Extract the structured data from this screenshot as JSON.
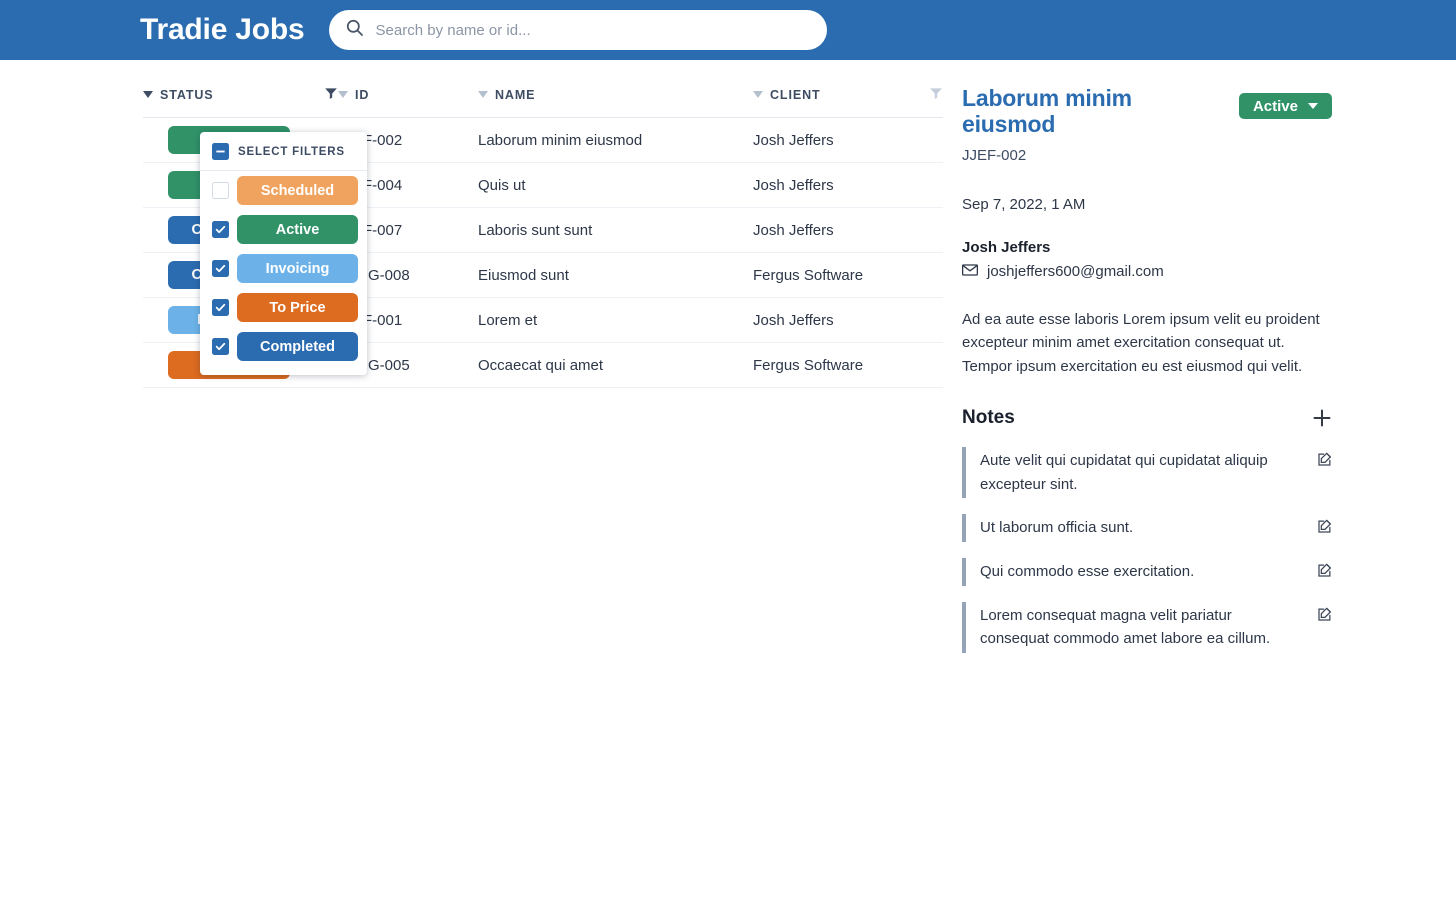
{
  "app": {
    "brand": "Tradie Jobs",
    "header_bg": "#2b6cb0"
  },
  "search": {
    "placeholder": "Search by name or id...",
    "value": "",
    "icon": "search-icon"
  },
  "table": {
    "columns": [
      {
        "label": "STATUS",
        "sort_icon": "caret-down-icon",
        "filter_icon": "funnel-icon",
        "filter_active": true
      },
      {
        "label": "ID",
        "sort_icon": "caret-down-icon",
        "filter_icon": null,
        "filter_active": false
      },
      {
        "label": "NAME",
        "sort_icon": "caret-down-icon",
        "filter_icon": null,
        "filter_active": false
      },
      {
        "label": "CLIENT",
        "sort_icon": "caret-down-icon",
        "filter_icon": "funnel-icon",
        "filter_active": false
      }
    ],
    "rows": [
      {
        "status": "Active",
        "status_color": "#319268",
        "id": "JJEF-002",
        "name": "Laborum minim eiusmod",
        "client": "Josh Jeffers"
      },
      {
        "status": "Active",
        "status_color": "#319268",
        "id": "JJEF-004",
        "name": "Quis ut",
        "client": "Josh Jeffers"
      },
      {
        "status": "Completed",
        "status_color": "#2b6cb0",
        "id": "JJEF-007",
        "name": "Laboris sunt sunt",
        "client": "Josh Jeffers"
      },
      {
        "status": "Completed",
        "status_color": "#2b6cb0",
        "id": "FERG-008",
        "name": "Eiusmod sunt",
        "client": "Fergus Software"
      },
      {
        "status": "Invoicing",
        "status_color": "#6cb2e8",
        "id": "JJEF-001",
        "name": "Lorem et",
        "client": "Josh Jeffers"
      },
      {
        "status": "To Price",
        "status_color": "#dd6b20",
        "id": "FERG-005",
        "name": "Occaecat qui amet",
        "client": "Fergus Software"
      }
    ]
  },
  "filter_popup": {
    "title": "SELECT FILTERS",
    "master_state": "indeterminate",
    "options": [
      {
        "label": "Scheduled",
        "color": "#f0a35e",
        "checked": false
      },
      {
        "label": "Active",
        "color": "#319268",
        "checked": true
      },
      {
        "label": "Invoicing",
        "color": "#6cb2e8",
        "checked": true
      },
      {
        "label": "To Price",
        "color": "#dd6b20",
        "checked": true
      },
      {
        "label": "Completed",
        "color": "#2b6cb0",
        "checked": true
      }
    ]
  },
  "detail": {
    "title": "Laborum minim eiusmod",
    "job_id": "JJEF-002",
    "status_label": "Active",
    "status_color": "#319268",
    "date": "Sep 7, 2022, 1 AM",
    "contact_name": "Josh Jeffers",
    "email": "joshjeffers600@gmail.com",
    "email_icon": "envelope-icon",
    "description": "Ad ea aute esse laboris Lorem ipsum velit eu proident excepteur minim amet exercitation consequat ut. Tempor ipsum exercitation eu est eiusmod qui velit.",
    "notes": {
      "title": "Notes",
      "add_icon": "plus-icon",
      "edit_icon": "edit-icon",
      "items": [
        {
          "text": "Aute velit qui cupidatat qui cupidatat aliquip excepteur sint."
        },
        {
          "text": "Ut laborum officia sunt."
        },
        {
          "text": "Qui commodo esse exercitation."
        },
        {
          "text": "Lorem consequat magna velit pariatur consequat commodo amet labore ea cillum."
        }
      ]
    }
  }
}
